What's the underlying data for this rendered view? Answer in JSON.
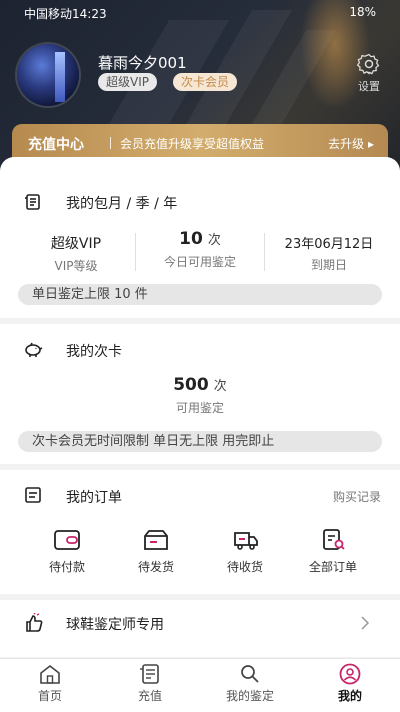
{
  "status_bar": {
    "left": "中国移动14:23",
    "right": "18%"
  },
  "profile": {
    "username": "暮雨今夕001",
    "badge_vip": "超级VIP",
    "badge_card": "次卡会员",
    "settings_label": "设置"
  },
  "recharge": {
    "title": "充值中心",
    "desc": "会员充值升级享受超值权益",
    "upgrade": "去升级 ▸"
  },
  "monthly": {
    "title": "我的包月 / 季 / 年",
    "level_value": "超级VIP",
    "level_label": "VIP等级",
    "today_value": "10",
    "today_unit": "次",
    "today_label": "今日可用鉴定",
    "expire_value": "23年06月12日",
    "expire_label": "到期日",
    "limit_note": "单日鉴定上限 10 件"
  },
  "times_card": {
    "title": "我的次卡",
    "count_value": "500",
    "count_unit": "次",
    "count_label": "可用鉴定",
    "note": "次卡会员无时间限制 单日无上限 用完即止"
  },
  "orders": {
    "title": "我的订单",
    "history_link": "购买记录",
    "items": [
      "待付款",
      "待发货",
      "待收货",
      "全部订单"
    ]
  },
  "appraiser": {
    "title": "球鞋鉴定师专用"
  },
  "tabbar": {
    "tabs": [
      "首页",
      "充值",
      "我的鉴定",
      "我的"
    ]
  },
  "colors": {
    "accent": "#c8246a",
    "gold": "#c9a062",
    "card_badge_text": "#c58a4a"
  }
}
